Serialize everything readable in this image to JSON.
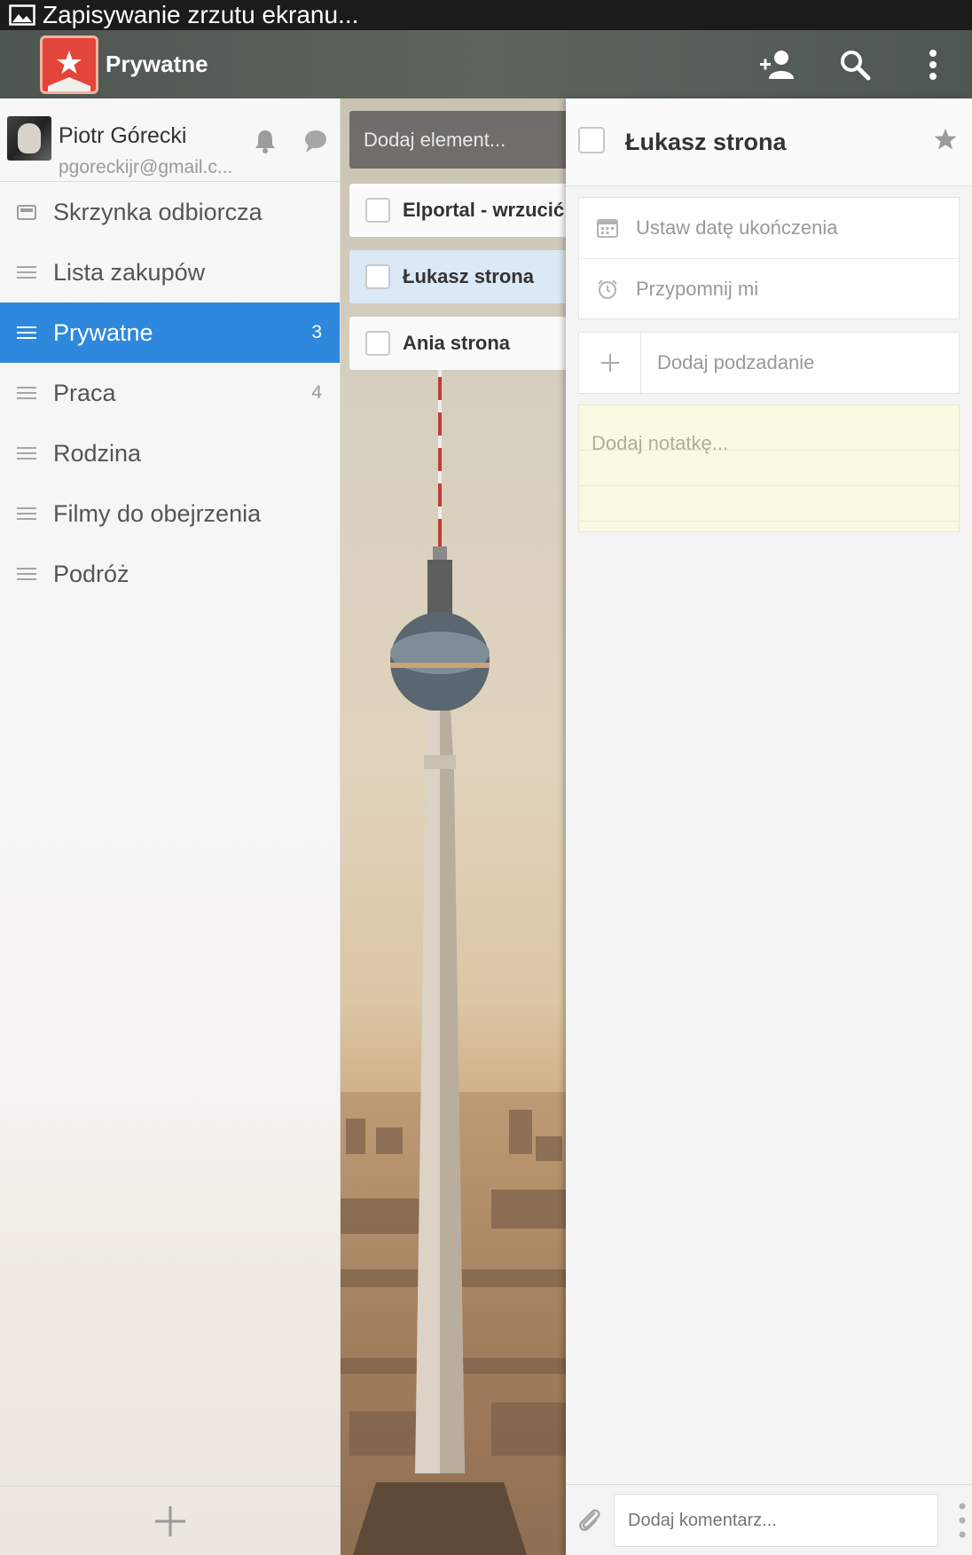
{
  "status_bar": {
    "text": "Zapisywanie zrzutu ekranu..."
  },
  "app_bar": {
    "title": "Prywatne"
  },
  "profile": {
    "name": "Piotr Górecki",
    "email": "pgoreckijr@gmail.c..."
  },
  "sidebar": {
    "items": [
      {
        "label": "Skrzynka odbiorcza",
        "count": "",
        "icon": "inbox-icon"
      },
      {
        "label": "Lista zakupów",
        "count": "",
        "icon": "list-icon"
      },
      {
        "label": "Prywatne",
        "count": "3",
        "icon": "list-icon",
        "active": true
      },
      {
        "label": "Praca",
        "count": "4",
        "icon": "list-icon"
      },
      {
        "label": "Rodzina",
        "count": "",
        "icon": "list-icon"
      },
      {
        "label": "Filmy do obejrzenia",
        "count": "",
        "icon": "list-icon"
      },
      {
        "label": "Podróż",
        "count": "",
        "icon": "list-icon"
      }
    ]
  },
  "tasks": {
    "add_placeholder": "Dodaj element...",
    "items": [
      {
        "label": "Elportal - wrzucić"
      },
      {
        "label": "Łukasz strona",
        "selected": true
      },
      {
        "label": "Ania strona"
      }
    ]
  },
  "detail": {
    "title": "Łukasz strona",
    "due_date": "Ustaw datę ukończenia",
    "remind": "Przypomnij mi",
    "subtask": "Dodaj podzadanie",
    "note": "Dodaj notatkę...",
    "comment_placeholder": "Dodaj komentarz..."
  },
  "colors": {
    "accent": "#2e88dd",
    "logo": "#e2463a",
    "appbar": "#555c56"
  }
}
